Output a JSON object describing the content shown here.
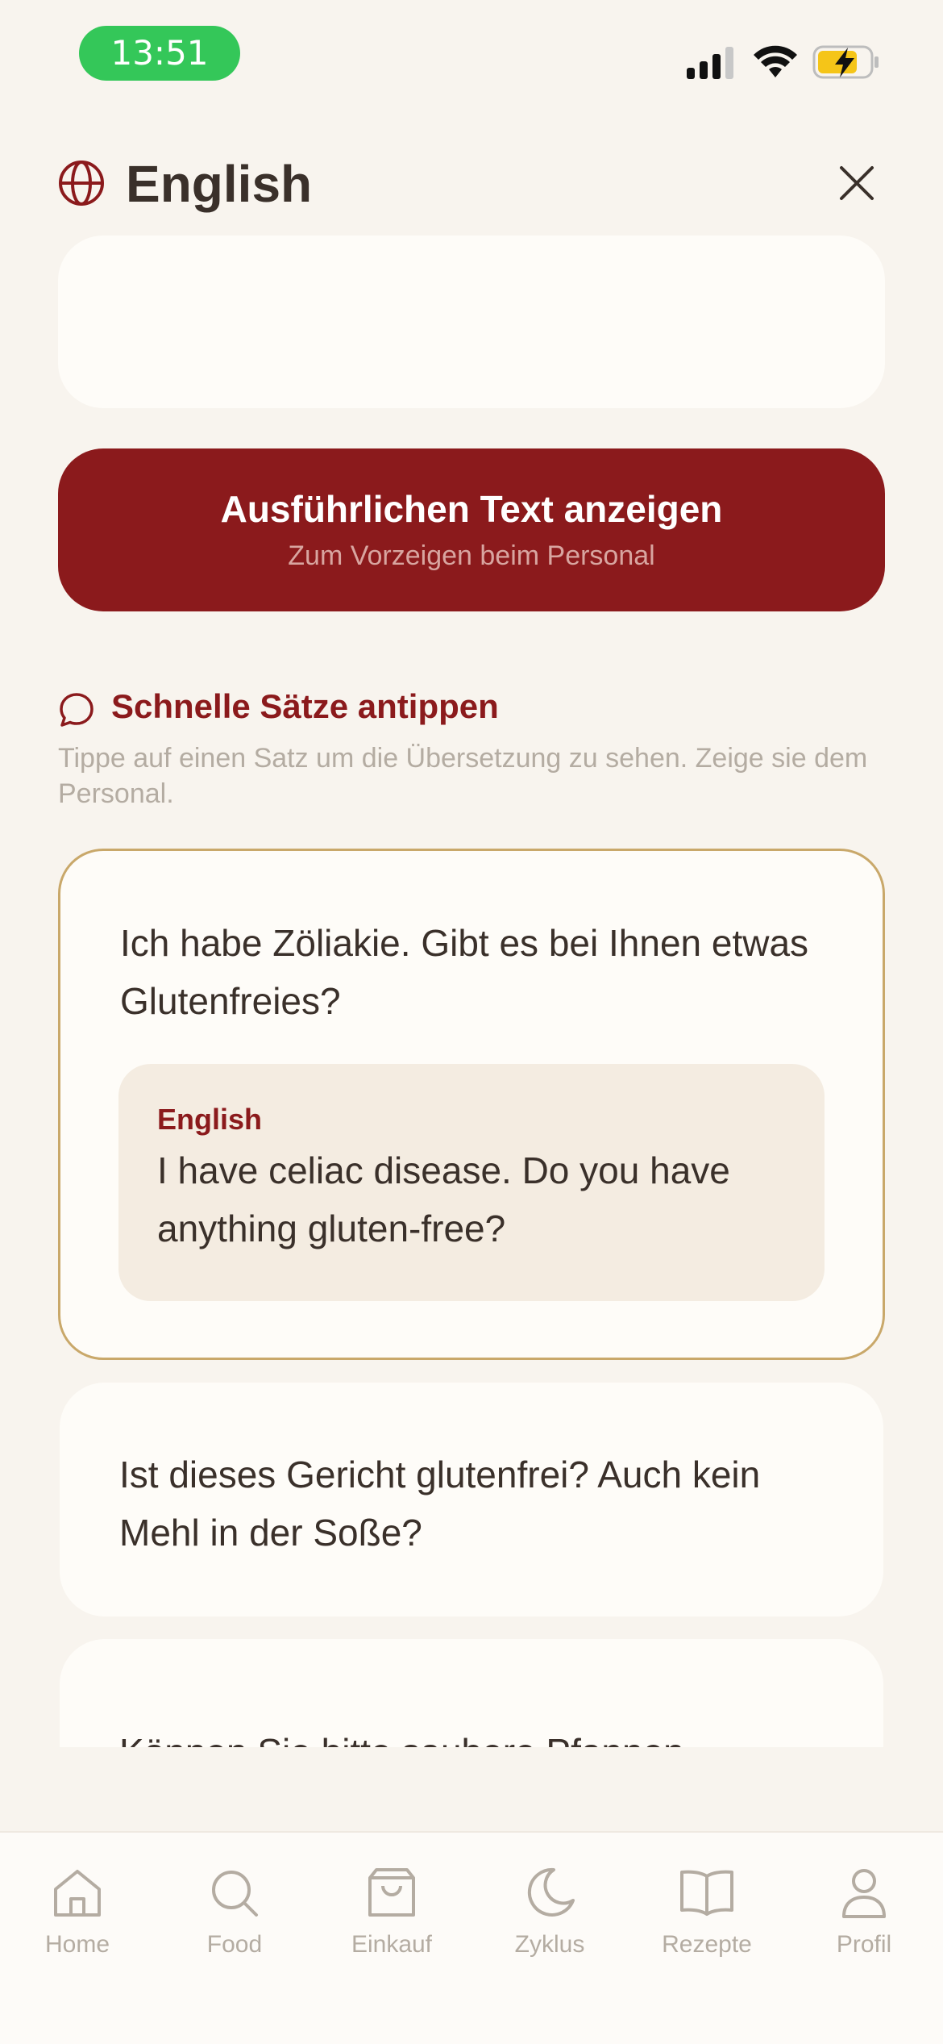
{
  "status_bar": {
    "time": "13:51",
    "icons": [
      "cellular-signal-icon",
      "wifi-icon",
      "battery-charging-icon"
    ]
  },
  "header": {
    "title": "English",
    "icon": "globe-icon",
    "close_icon": "close-icon"
  },
  "detail_button": {
    "label": "Ausführlichen Text anzeigen",
    "sublabel": "Zum Vorzeigen beim Personal"
  },
  "quick_phrases": {
    "icon": "speech-bubble-icon",
    "title": "Schnelle Sätze antippen",
    "hint": "Tippe auf einen Satz um die Übersetzung zu sehen. Zeige sie dem Personal.",
    "items": [
      {
        "text": "Ich habe Zöliakie. Gibt es bei Ihnen etwas Glutenfreies?",
        "expanded": true,
        "translation_language": "English",
        "translation": "I have celiac disease. Do you have anything gluten-free?"
      },
      {
        "text": "Ist dieses Gericht glutenfrei? Auch kein Mehl in der Soße?",
        "expanded": false
      },
      {
        "text": "Können Sie bitte saubere Pfannen",
        "expanded": false
      }
    ]
  },
  "tab_bar": {
    "items": [
      {
        "label": "Home",
        "icon": "home-icon"
      },
      {
        "label": "Food",
        "icon": "search-icon"
      },
      {
        "label": "Einkauf",
        "icon": "shopping-bag-icon"
      },
      {
        "label": "Zyklus",
        "icon": "moon-icon"
      },
      {
        "label": "Rezepte",
        "icon": "book-icon"
      },
      {
        "label": "Profil",
        "icon": "person-icon"
      }
    ]
  },
  "colors": {
    "background": "#f8f4ee",
    "card": "#fefcf8",
    "accent": "#8b1a1c",
    "active_border": "#c9a86a",
    "translation_bg": "#f4ece1",
    "muted_text": "#b4aca2",
    "status_green": "#34c759"
  }
}
